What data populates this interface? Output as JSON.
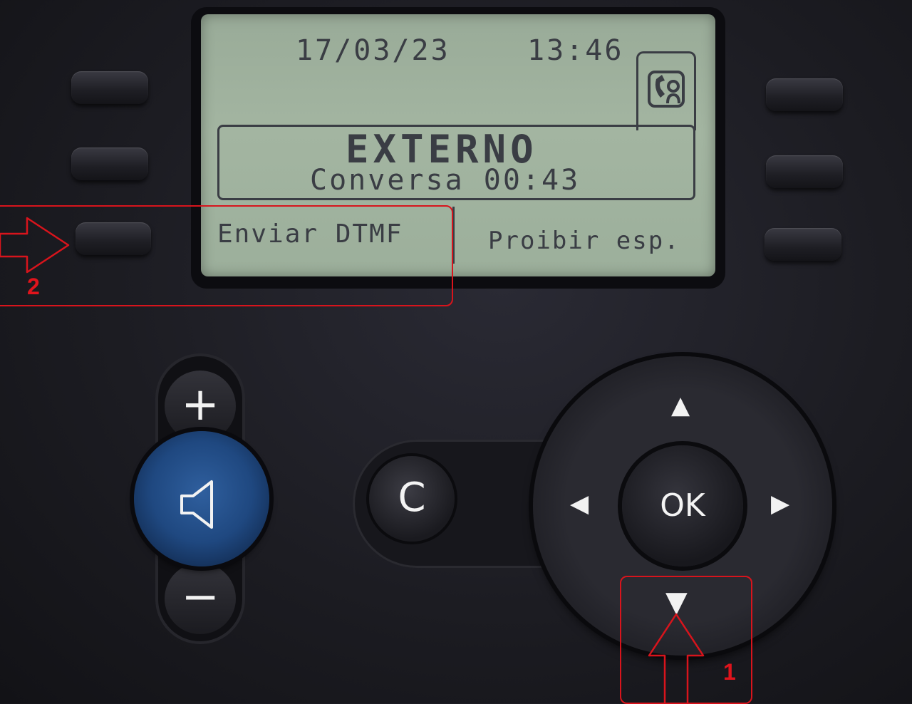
{
  "display": {
    "date": "17/03/23",
    "time": "13:46",
    "call_title": "EXTERNO",
    "call_status": "Conversa 00:43",
    "softkey_left": "Enviar DTMF",
    "softkey_right": "Proibir esp.",
    "status_icon": "phone-call-icon"
  },
  "keypad": {
    "volume_up": "+",
    "volume_down": "−",
    "clear": "C",
    "ok": "OK",
    "speaker_icon": "speaker-icon",
    "nav_arrows": [
      "▲",
      "▼",
      "◀",
      "▶"
    ]
  },
  "annotations": {
    "step_1": "1",
    "step_2": "2",
    "color": "#d8141c"
  }
}
